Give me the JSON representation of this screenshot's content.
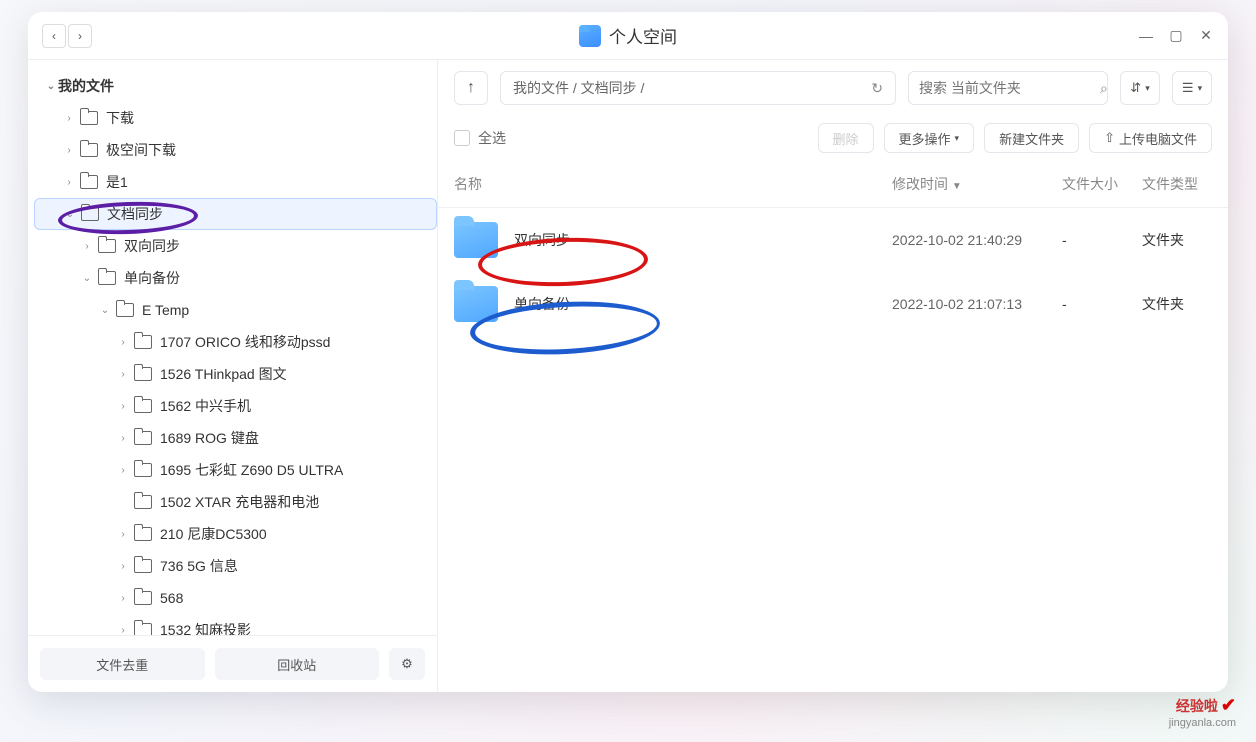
{
  "window": {
    "title": "个人空间"
  },
  "nav": {
    "back": "‹",
    "forward": "›"
  },
  "sidebar": {
    "root": "我的文件",
    "items": [
      {
        "label": "下载",
        "indent": 1,
        "exp": "›"
      },
      {
        "label": "极空间下载",
        "indent": 1,
        "exp": "›"
      },
      {
        "label": "是1",
        "indent": 1,
        "exp": "›"
      },
      {
        "label": "文档同步",
        "indent": 1,
        "exp": "⌄",
        "selected": true
      },
      {
        "label": "双向同步",
        "indent": 2,
        "exp": "›"
      },
      {
        "label": "单向备份",
        "indent": 2,
        "exp": "⌄"
      },
      {
        "label": "E Temp",
        "indent": 3,
        "exp": "⌄"
      },
      {
        "label": "1707 ORICO 线和移动pssd",
        "indent": 4,
        "exp": "›"
      },
      {
        "label": "1526 THinkpad 图文",
        "indent": 4,
        "exp": "›"
      },
      {
        "label": "1562 中兴手机",
        "indent": 4,
        "exp": "›"
      },
      {
        "label": "1689 ROG 键盘",
        "indent": 4,
        "exp": "›"
      },
      {
        "label": "1695 七彩虹 Z690 D5 ULTRA",
        "indent": 4,
        "exp": "›"
      },
      {
        "label": "1502 XTAR 充电器和电池",
        "indent": 4,
        "exp": ""
      },
      {
        "label": "210 尼康DC5300",
        "indent": 4,
        "exp": "›"
      },
      {
        "label": "736 5G 信息",
        "indent": 4,
        "exp": "›"
      },
      {
        "label": "568",
        "indent": 4,
        "exp": "›"
      },
      {
        "label": "1532 知麻投影",
        "indent": 4,
        "exp": "›"
      }
    ],
    "footer": {
      "dedup": "文件去重",
      "trash": "回收站"
    }
  },
  "toolbar": {
    "path": "我的文件 / 文档同步 /",
    "refresh": "↻",
    "search_placeholder": "搜索 当前文件夹",
    "sort": "⇅",
    "view": "☰"
  },
  "actions": {
    "select_all": "全选",
    "delete": "删除",
    "more": "更多操作",
    "new_folder": "新建文件夹",
    "upload": "上传电脑文件"
  },
  "table": {
    "headers": {
      "name": "名称",
      "time": "修改时间",
      "size": "文件大小",
      "type": "文件类型"
    },
    "rows": [
      {
        "name": "双向同步",
        "time": "2022-10-02 21:40:29",
        "size": "-",
        "type": "文件夹"
      },
      {
        "name": "单向备份",
        "time": "2022-10-02 21:07:13",
        "size": "-",
        "type": "文件夹"
      }
    ]
  },
  "brand": {
    "name": "经验啦",
    "url": "jingyanla.com"
  }
}
